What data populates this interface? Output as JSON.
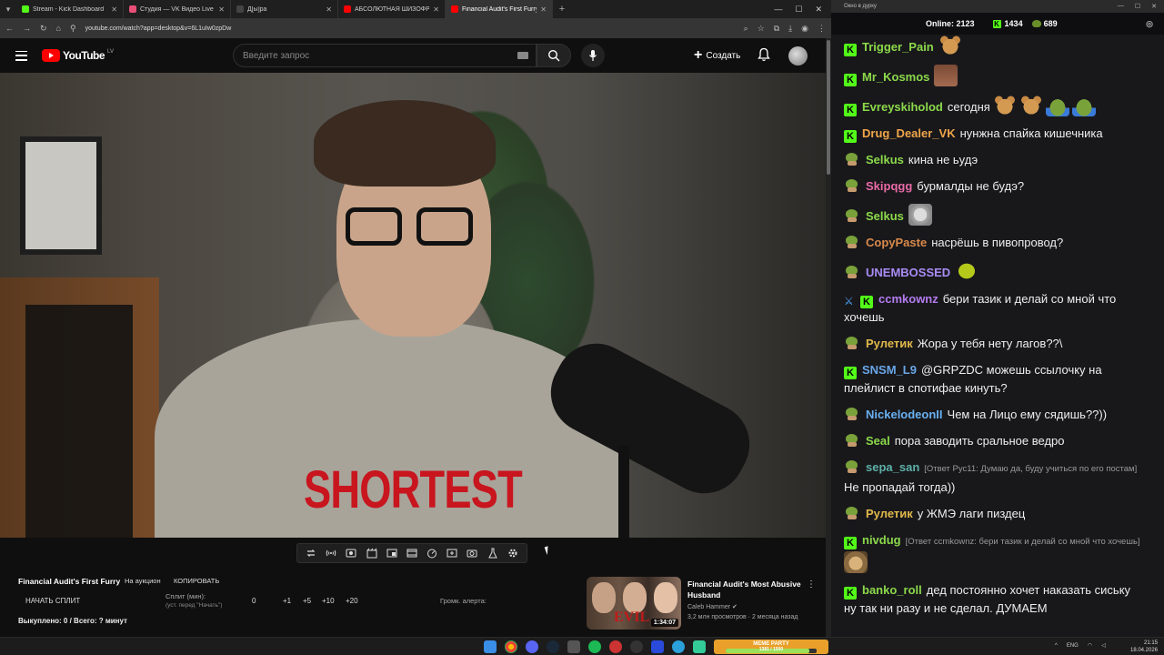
{
  "browser": {
    "tabs": [
      {
        "title": "Stream - Kick Dashboard",
        "color": "#53fc18",
        "active": false
      },
      {
        "title": "Студия — VK Видео Live",
        "color": "#e94e77",
        "active": false
      },
      {
        "title": "Д[ы]ра",
        "color": "#444444",
        "active": false
      },
      {
        "title": "АБСОЛЮТНАЯ ШИЗОФРЕНИЯ",
        "color": "#ff0000",
        "active": false
      },
      {
        "title": "Financial Audit's First Furry - Yo",
        "color": "#ff0000",
        "active": true
      }
    ],
    "url": "youtube.com/watch?app=desktop&v=6L1uIw0zpDw"
  },
  "youtube": {
    "logo_text": "YouTube",
    "region": "LV",
    "search_placeholder": "Введите запрос",
    "create_label": "Создать"
  },
  "video": {
    "caption": "SHORTEST"
  },
  "auction": {
    "title": "Financial Audit's First Furry",
    "status": "На аукцион",
    "copy_label": "КОПИРОВАТЬ",
    "start_split_label": "НАЧАТЬ СПЛИТ",
    "split_label": "Сплит (мин):",
    "split_hint": "(уст. перед \"Начать\")",
    "split_value": "0",
    "increments": [
      "+1",
      "+5",
      "+10",
      "+20"
    ],
    "alert_volume_label": "Громк. алерта:",
    "bought_label": "Выкуплено: 0 / Всего: ? минут"
  },
  "recommendation": {
    "title": "Financial Audit's Most Abusive Husband",
    "channel": "Caleb Hammer",
    "meta": "3,2 млн просмотров · 2 месяца назад",
    "duration": "1:34:07",
    "thumb_text": "EVIL"
  },
  "chat_window": {
    "title": "Окно в дурку",
    "online_label": "Online:",
    "online_count": "2123",
    "kick_count": "1434",
    "other_count": "689"
  },
  "chat": [
    {
      "badge": "kick",
      "user": "Trigger_Pain",
      "color": "#8cd94a",
      "text": "",
      "emotes": [
        "bear"
      ]
    },
    {
      "badge": "kick",
      "user": "Mr_Kosmos",
      "color": "#8cd94a",
      "text": "",
      "emotes": [
        "face"
      ]
    },
    {
      "badge": "kick",
      "user": "Evreyskiholod",
      "color": "#8cd94a",
      "text": "сегодня",
      "emotes": [
        "bear",
        "bear",
        "frog",
        "frog"
      ]
    },
    {
      "badge": "kick",
      "user": "Drug_Dealer_VK",
      "color": "#f0a64a",
      "text": "нунжна спайка кишечника",
      "emotes": []
    },
    {
      "badge": "pepe",
      "user": "Selkus",
      "color": "#8cd94a",
      "text": "кина не ьудэ",
      "emotes": []
    },
    {
      "badge": "pepe",
      "user": "Skipqgg",
      "color": "#e86aa6",
      "text": "бурмалды не будэ?",
      "emotes": []
    },
    {
      "badge": "pepe",
      "user": "Selkus",
      "color": "#8cd94a",
      "text": "",
      "emotes": [
        "cat"
      ]
    },
    {
      "badge": "pepe",
      "user": "CopyPaste",
      "color": "#d98a4a",
      "text": "насрёшь в пивопровод?",
      "emotes": []
    },
    {
      "badge": "pepe",
      "user": "UNEMBOSSED",
      "color": "#a98cf5",
      "text": "",
      "emotes": [
        "pepe"
      ]
    },
    {
      "badge": "sword",
      "user": "ccmkownz",
      "color": "#b57cf0",
      "text": "бери тазик и делай со мной что хочешь",
      "emotes": []
    },
    {
      "badge": "pepe",
      "user": "Рулетик",
      "color": "#e0b84a",
      "text": "Жора у тебя нету лагов??\\",
      "emotes": []
    },
    {
      "badge": "kick",
      "user": "SNSM_L9",
      "color": "#6aa6e8",
      "text": "@GRPZDC можешь ссылочку на плейлист в спотифае кинуть?",
      "emotes": []
    },
    {
      "badge": "pepe",
      "user": "NickelodeonII",
      "color": "#6ab0f0",
      "text": "Чем на Лицо ему сядишь??))",
      "emotes": []
    },
    {
      "badge": "pepe",
      "user": "Seal",
      "color": "#8cd94a",
      "text": "пора заводить сральное ведро",
      "emotes": []
    },
    {
      "badge": "pepe",
      "user": "sepa_san",
      "color": "#5fb0a8",
      "reply": "[Ответ Рус11: Думаю да, буду учиться по его постам]",
      "text": "Не пропадай тогда))",
      "emotes": []
    },
    {
      "badge": "pepe",
      "user": "Рулетик",
      "color": "#e0b84a",
      "text": "у ЖМЭ лаги пиздец",
      "emotes": []
    },
    {
      "badge": "kick",
      "user": "nivdug",
      "color": "#8cd94a",
      "reply": "[Ответ ccmkownz: бери тазик и делай со мной что хочешь]",
      "text": "",
      "emotes": [
        "cat2"
      ]
    },
    {
      "badge": "kick",
      "user": "banko_roll",
      "color": "#8cd94a",
      "text": "дед постоянно хочет наказать сиську ну так ни разу и не сделал. ДУМАЕМ",
      "emotes": []
    }
  ],
  "taskbar": {
    "meme_title": "MEME PARTY",
    "meme_progress_text": "1381 / 1500",
    "meme_progress": 0.92,
    "lang": "ENG",
    "time": "21:15",
    "date": "18.04.2026"
  }
}
